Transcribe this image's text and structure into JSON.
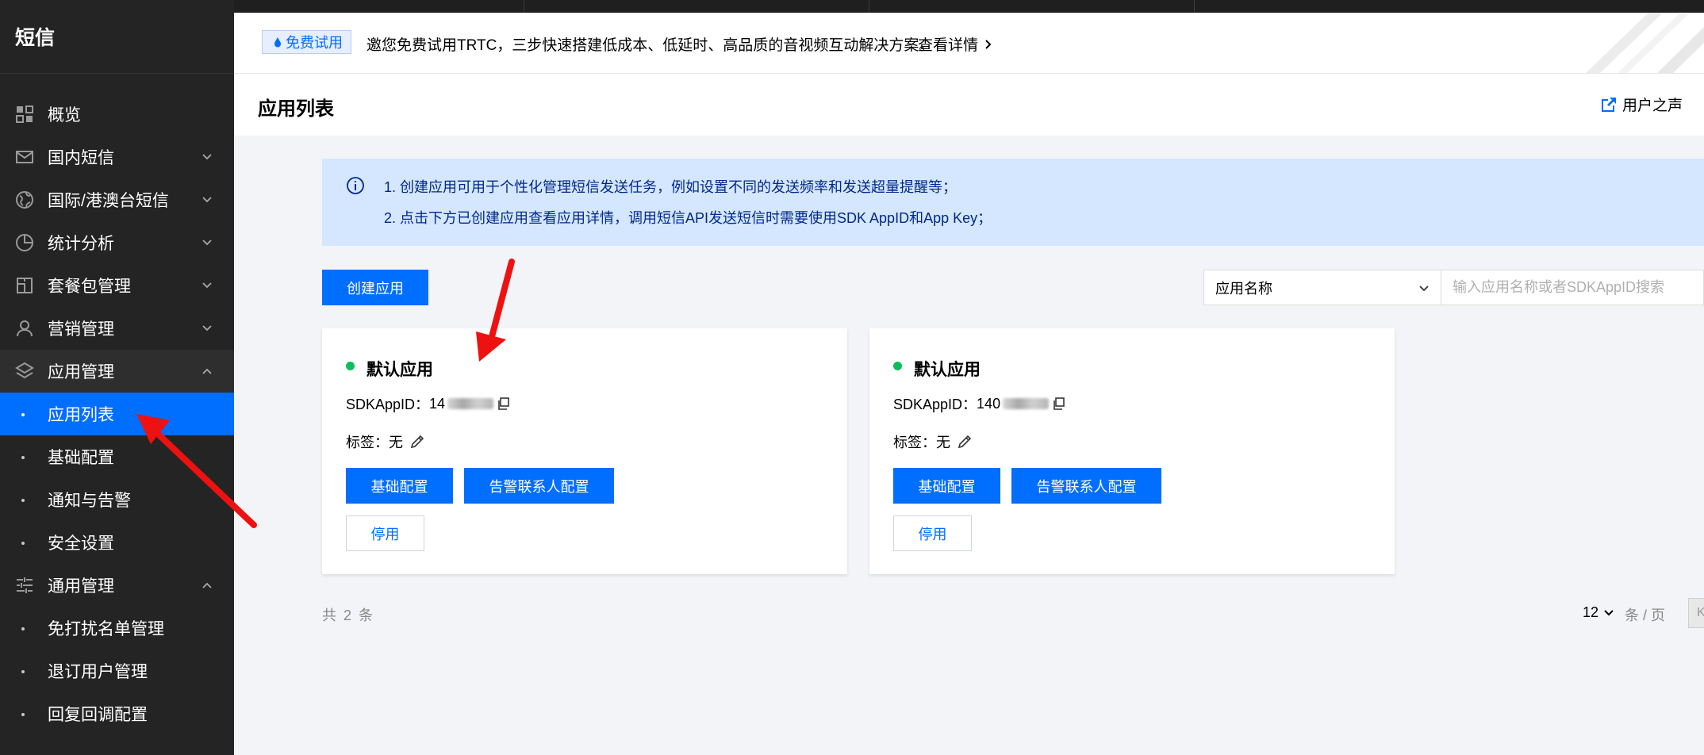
{
  "sidebar": {
    "brand": "短信",
    "items": [
      {
        "label": "概览",
        "icon": "dashboard-icon"
      },
      {
        "label": "国内短信",
        "icon": "mail-icon"
      },
      {
        "label": "国际/港澳台短信",
        "icon": "globe-icon"
      },
      {
        "label": "统计分析",
        "icon": "pie-chart-icon"
      },
      {
        "label": "套餐包管理",
        "icon": "package-icon"
      },
      {
        "label": "营销管理",
        "icon": "user-icon"
      },
      {
        "label": "应用管理",
        "icon": "layers-icon"
      },
      {
        "label": "通用管理",
        "icon": "sliders-icon"
      }
    ],
    "app_sub": [
      "应用列表",
      "基础配置",
      "通知与告警",
      "安全设置"
    ],
    "general_sub": [
      "免打扰名单管理",
      "退订用户管理",
      "回复回调配置"
    ]
  },
  "banner": {
    "tag": "免费试用",
    "text": "邀您免费试用TRTC，三步快速搭建低成本、低延时、高品质的音视频互动解决方案。",
    "link": "查看详情"
  },
  "header": {
    "title": "应用列表",
    "feedback": "用户之声"
  },
  "info": {
    "line1": "1. 创建应用可用于个性化管理短信发送任务，例如设置不同的发送频率和发送超量提醒等；",
    "line2": "2. 点击下方已创建应用查看应用详情，调用短信API发送短信时需要使用SDK AppID和App Key；"
  },
  "toolbar": {
    "create": "创建应用",
    "filter": "应用名称",
    "search_placeholder": "输入应用名称或者SDKAppID搜索"
  },
  "cards": [
    {
      "name": "默认应用",
      "appid_label": "SDKAppID：",
      "appid_prefix": "14",
      "tag_label": "标签：无",
      "btn_basic": "基础配置",
      "btn_contact": "告警联系人配置",
      "btn_disable": "停用"
    },
    {
      "name": "默认应用",
      "appid_label": "SDKAppID：",
      "appid_prefix": "140",
      "tag_label": "标签：无",
      "btn_basic": "基础配置",
      "btn_contact": "告警联系人配置",
      "btn_disable": "停用"
    }
  ],
  "footer": {
    "total": "共 2 条",
    "page_size": "12",
    "page_unit": "条 / 页",
    "first_page": "K"
  },
  "colors": {
    "primary": "#006eff",
    "sidebar_bg": "#242424",
    "status_green": "#0abf5b",
    "annotation_red": "#ee1111"
  }
}
